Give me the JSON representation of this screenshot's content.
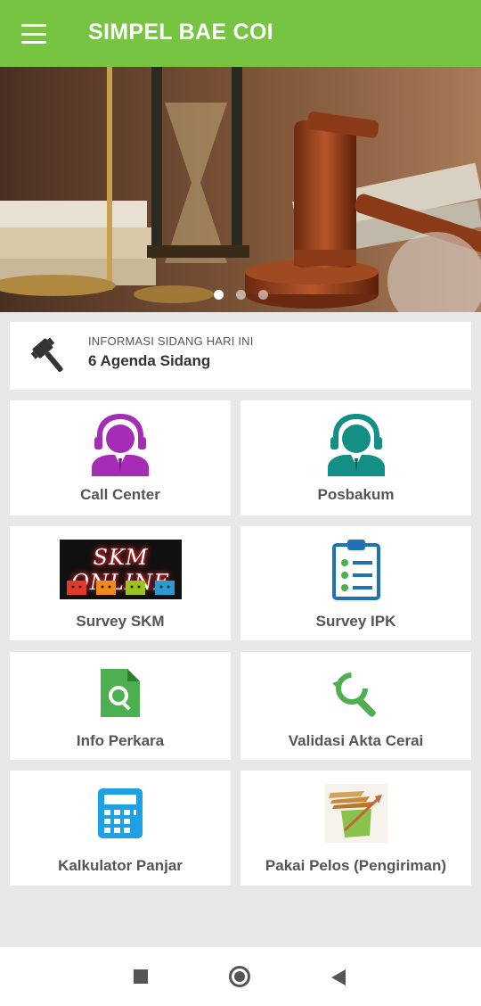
{
  "appbar": {
    "title": "SIMPEL BAE COI"
  },
  "banner": {
    "slide_count": 3,
    "active_slide": 1
  },
  "info": {
    "label": "INFORMASI SIDANG HARI INI",
    "value": "6 Agenda Sidang"
  },
  "menu": {
    "call_center": "Call Center",
    "posbakum": "Posbakum",
    "survey_skm": "Survey SKM",
    "skm_image_text": "SKM ONLINE",
    "survey_ipk": "Survey IPK",
    "info_perkara": "Info Perkara",
    "validasi_akta": "Validasi Akta Cerai",
    "kalkulator": "Kalkulator Panjar",
    "pakai_pelos": "Pakai Pelos (Pengiriman)"
  },
  "colors": {
    "appbar": "#76c442",
    "call_center_icon": "#a52db5",
    "posbakum_icon": "#138f85",
    "survey_ipk_icon": "#1e73b5",
    "info_perkara_icon": "#4caf50",
    "validasi_icon": "#4caf50",
    "kalkulator_icon": "#1ea0e6"
  }
}
